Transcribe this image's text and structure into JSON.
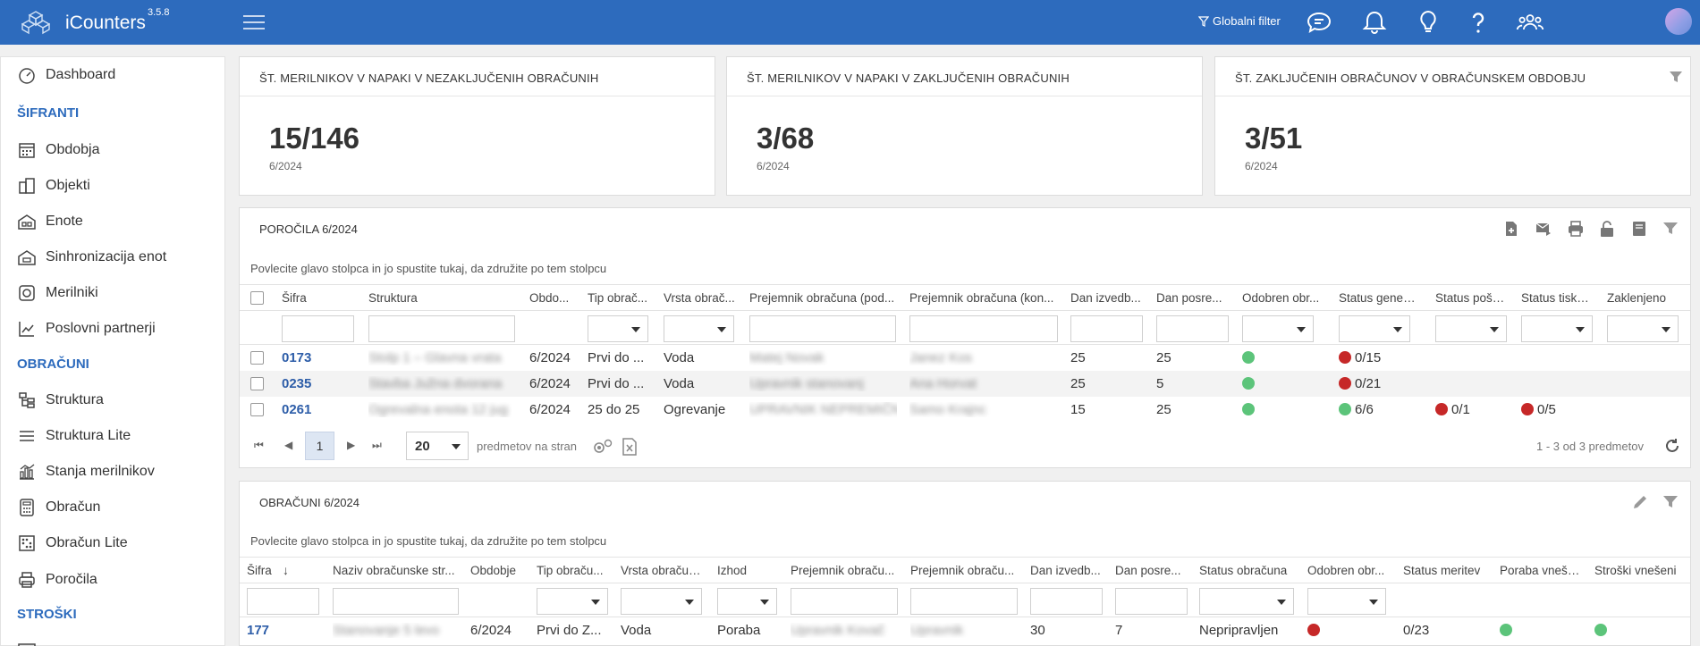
{
  "app": {
    "name": "iCounters",
    "version": "3.5.8"
  },
  "topbar": {
    "global_filter": "Globalni filter",
    "icons": [
      "chat-icon",
      "bell-icon",
      "lightbulb-icon",
      "help-icon",
      "users-icon",
      "avatar"
    ]
  },
  "sidebar": {
    "dashboard": "Dashboard",
    "sections": {
      "sifranti": "ŠIFRANTI",
      "obracuni": "OBRAČUNI",
      "stroski": "STROŠKI"
    },
    "items": {
      "obdobja": "Obdobja",
      "objekti": "Objekti",
      "enote": "Enote",
      "sinhronizacija": "Sinhronizacija enot",
      "merilniki": "Merilniki",
      "partnerji": "Poslovni partnerji",
      "struktura": "Struktura",
      "struktura_lite": "Struktura Lite",
      "stanja": "Stanja merilnikov",
      "obracun": "Obračun",
      "obracun_lite": "Obračun Lite",
      "porocila": "Poročila"
    }
  },
  "stats": [
    {
      "title": "ŠT. MERILNIKOV V NAPAKI V NEZAKLJUČENIH OBRAČUNIH",
      "value": "15/146",
      "period": "6/2024"
    },
    {
      "title": "ŠT. MERILNIKOV V NAPAKI V ZAKLJUČENIH OBRAČUNIH",
      "value": "3/68",
      "period": "6/2024"
    },
    {
      "title": "ŠT. ZAKLJUČENIH OBRAČUNOV V OBRAČUNSKEM OBDOBJU",
      "value": "3/51",
      "period": "6/2024"
    }
  ],
  "reports": {
    "title": "POROČILA 6/2024",
    "hint": "Povlecite glavo stolpca in jo spustite tukaj, da združite po tem stolpcu",
    "columns": [
      "Šifra",
      "Struktura",
      "Obdo...",
      "Tip obrač...",
      "Vrsta obrač...",
      "Prejemnik obračuna (pod...",
      "Prejemnik obračuna (kon...",
      "Dan izvedb...",
      "Dan posre...",
      "Odobren obr...",
      "Status generi...",
      "Status pošil...",
      "Status tiska...",
      "Zaklenjeno"
    ],
    "rows": [
      {
        "sifra": "0173",
        "struktura": "Stolp 1 – Glavna vrata",
        "obdobje": "6/2024",
        "tip": "Prvi do ...",
        "vrsta": "Voda",
        "prejemnik_pod": "Matej Novak",
        "prejemnik_kon": "Janez Kos",
        "dan_izv": "25",
        "dan_pos": "25",
        "odobren": "green",
        "status_gen": {
          "dot": "red",
          "text": "0/15"
        },
        "status_pos": null,
        "status_tis": null
      },
      {
        "sifra": "0235",
        "struktura": "Stavba Južna dvorana",
        "obdobje": "6/2024",
        "tip": "Prvi do ...",
        "vrsta": "Voda",
        "prejemnik_pod": "Upravnik stanovanj",
        "prejemnik_kon": "Ana Horvat",
        "dan_izv": "25",
        "dan_pos": "5",
        "odobren": "green",
        "status_gen": {
          "dot": "red",
          "text": "0/21"
        },
        "status_pos": null,
        "status_tis": null
      },
      {
        "sifra": "0261",
        "struktura": "Ogrevalna enota 12 jug",
        "obdobje": "6/2024",
        "tip": "25 do 25",
        "vrsta": "Ogrevanje",
        "prejemnik_pod": "UPRAVNIK NEPREMIČNIN",
        "prejemnik_kon": "Samo Krajnc",
        "dan_izv": "15",
        "dan_pos": "25",
        "odobren": "green",
        "status_gen": {
          "dot": "green",
          "text": "6/6"
        },
        "status_pos": {
          "dot": "red",
          "text": "0/1"
        },
        "status_tis": {
          "dot": "red",
          "text": "0/5"
        }
      }
    ],
    "pager": {
      "page": "1",
      "size": "20",
      "per_page_label": "predmetov na stran",
      "summary": "1 - 3 od 3 predmetov"
    }
  },
  "settlements": {
    "title": "OBRAČUNI 6/2024",
    "hint": "Povlecite glavo stolpca in jo spustite tukaj, da združite po tem stolpcu",
    "columns": [
      "Šifra",
      "Naziv obračunske str...",
      "Obdobje",
      "Tip obraču...",
      "Vrsta obračuna",
      "Izhod",
      "Prejemnik obraču...",
      "Prejemnik obraču...",
      "Dan izvedb...",
      "Dan posre...",
      "Status obračuna",
      "Odobren obr...",
      "Status meritev",
      "Poraba vneše...",
      "Stroški vnešeni"
    ],
    "rows": [
      {
        "sifra": "177",
        "naziv": "Stanovanje 5 levo",
        "obdobje": "6/2024",
        "tip": "Prvi do Z...",
        "vrsta": "Voda",
        "izhod": "Poraba",
        "prej1": "Upravnik Kovač",
        "prej2": "Upravnik",
        "dan_izv": "30",
        "dan_pos": "7",
        "status": "Nepripravljen",
        "odobren": "red",
        "meritve": "0/23",
        "poraba": "green",
        "stroski": "green"
      }
    ]
  },
  "colors": {
    "brand": "#2d6bbd",
    "ok": "#5cc47a",
    "error": "#c62828"
  }
}
